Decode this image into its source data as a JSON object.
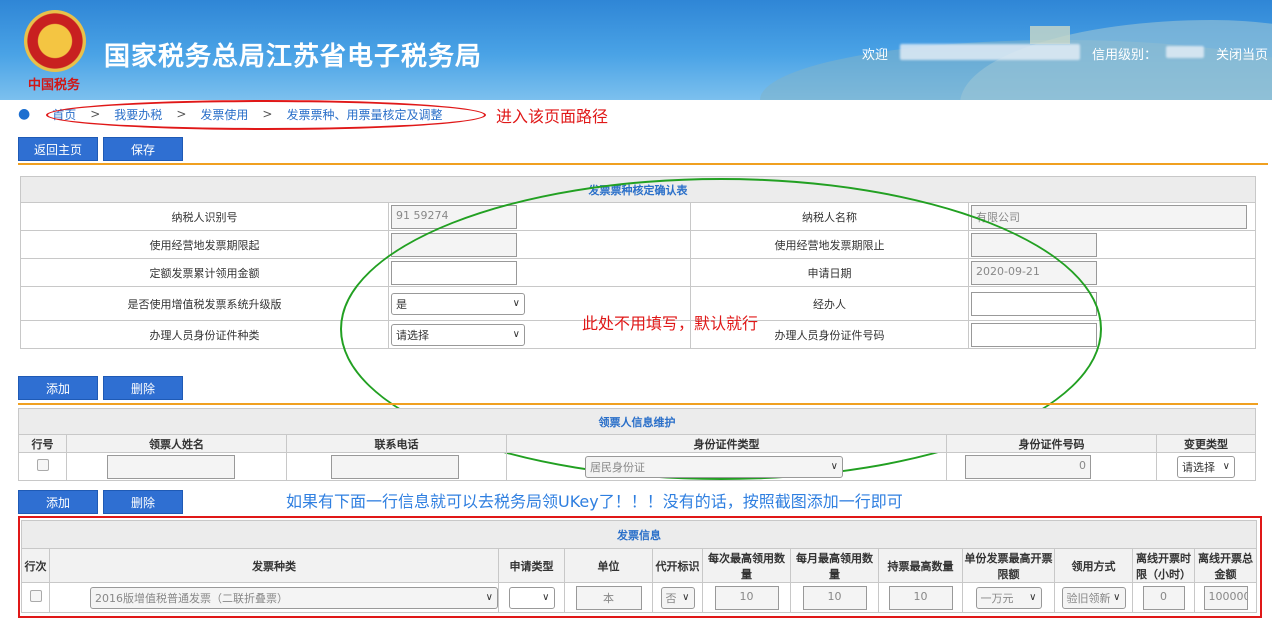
{
  "header": {
    "title": "国家税务总局江苏省电子税务局",
    "emblem_text": "中国税务",
    "welcome": "欢迎",
    "credit_label": "信用级别：",
    "close_page": "关闭当页"
  },
  "breadcrumb": {
    "items": [
      "首页",
      "我要办税",
      "发票使用",
      "发票票种、用票量核定及调整"
    ],
    "separator": ">",
    "note": "进入该页面路径"
  },
  "toolbar": {
    "back_label": "返回主页",
    "save_label": "保存"
  },
  "confirm_table": {
    "title": "发票票种核定确认表",
    "rows": [
      {
        "l1": "纳税人识别号",
        "v1": "91                    59274",
        "l2": "纳税人名称",
        "v2": "                          有限公司"
      },
      {
        "l1": "使用经营地发票期限起",
        "v1": "",
        "l2": "使用经营地发票期限止",
        "v2": ""
      },
      {
        "l1": "定额发票累计领用金额",
        "v1": "",
        "l2": "申请日期",
        "v2": "2020-09-21"
      },
      {
        "l1": "是否使用增值税发票系统升级版",
        "v1": "是",
        "l2": "经办人",
        "v2": ""
      },
      {
        "l1": "办理人员身份证件种类",
        "v1": "请选择",
        "l2": "办理人员身份证件号码",
        "v2": ""
      }
    ],
    "note": "此处不用填写，默认就行"
  },
  "recipient": {
    "add_label": "添加",
    "delete_label": "删除",
    "title": "领票人信息维护",
    "columns": [
      "行号",
      "领票人姓名",
      "联系电话",
      "身份证件类型",
      "身份证件号码",
      "变更类型"
    ],
    "row": {
      "name": "",
      "phone": "",
      "id_type": "居民身份证",
      "id_no": "0",
      "change_type": "请选择"
    }
  },
  "invoice": {
    "add_label": "添加",
    "delete_label": "删除",
    "note": "如果有下面一行信息就可以去税务局领UKey了！！！没有的话，按照截图添加一行即可",
    "title": "发票信息",
    "columns": [
      "行次",
      "发票种类",
      "申请类型",
      "单位",
      "代开标识",
      "每次最高领用数量",
      "每月最高领用数量",
      "持票最高数量",
      "单份发票最高开票限额",
      "领用方式",
      "离线开票时限（小时）",
      "离线开票总金额"
    ],
    "row": {
      "kind": "2016版增值税普通发票（二联折叠票）",
      "apply_type": "",
      "unit": "本",
      "agent": "否",
      "per_time": "10",
      "per_month": "10",
      "max_hold": "10",
      "limit": "一万元",
      "method": "验旧领新",
      "offline_hours": "0",
      "offline_amount": "100000"
    }
  }
}
